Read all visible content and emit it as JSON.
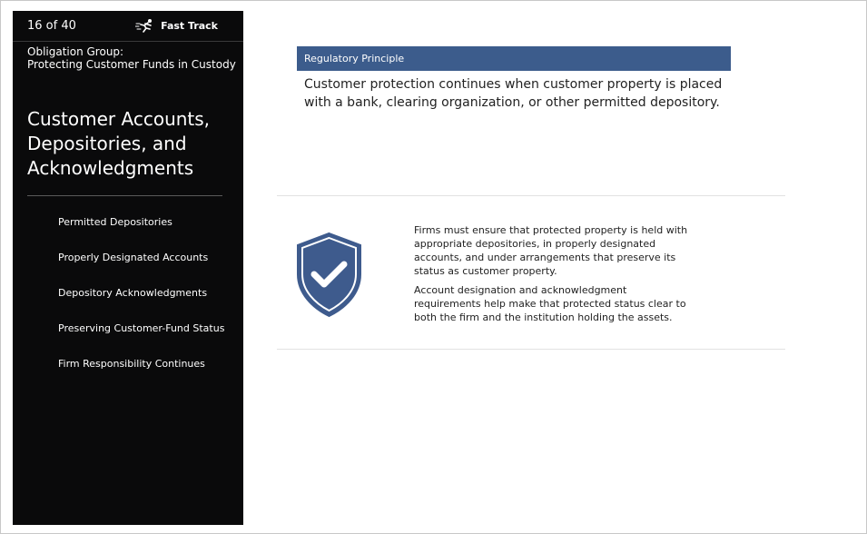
{
  "sidebar": {
    "page_count": "16 of 40",
    "brand": {
      "label": "Fast Track",
      "icon": "running-figure-icon"
    },
    "group": {
      "line1": "Obligation Group:",
      "line2": "Protecting Customer Funds in Custody"
    },
    "section_title": "Customer Accounts, Depositories, and Acknowledgments",
    "toc": [
      {
        "label": "Permitted Depositories"
      },
      {
        "label": "Properly Designated Accounts"
      },
      {
        "label": "Depository Acknowledgments"
      },
      {
        "label": "Preserving Customer-Fund Status"
      },
      {
        "label": "Firm Responsibility Continues"
      }
    ]
  },
  "main": {
    "principle": {
      "header": "Regulatory Principle",
      "body": "Customer protection continues when customer property is placed with a bank, clearing organization, or other permitted depository."
    },
    "detail": {
      "icon": "shield-check-icon",
      "paragraphs": [
        "Firms must ensure that protected property is held with appropriate depositories, in properly designated accounts, and under arrangements that preserve its status as customer property.",
        "Account designation and acknowledgment requirements help make that protected status clear to both the firm and the institution holding the assets."
      ]
    }
  },
  "colors": {
    "sidebar_bg": "#0a0a0b",
    "accent_blue": "#3c5c8c",
    "shield_blue": "#3e5b8d"
  }
}
